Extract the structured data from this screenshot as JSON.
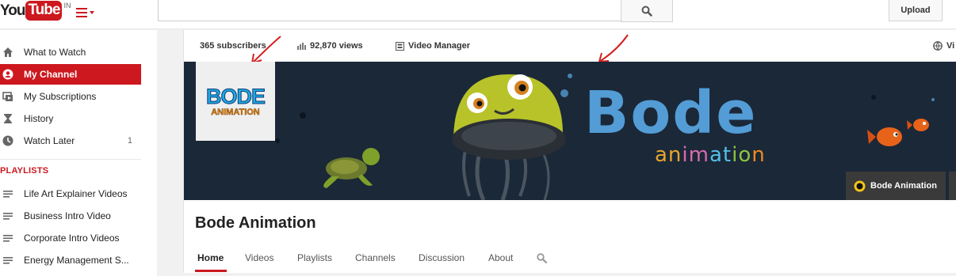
{
  "header": {
    "logo_you": "You",
    "logo_tube": "Tube",
    "region": "IN",
    "search_placeholder": "",
    "upload_label": "Upload"
  },
  "sidebar": {
    "items": [
      {
        "label": "What to Watch",
        "icon": "home-icon"
      },
      {
        "label": "My Channel",
        "icon": "user-icon",
        "active": true
      },
      {
        "label": "My Subscriptions",
        "icon": "subscriptions-icon"
      },
      {
        "label": "History",
        "icon": "hourglass-icon"
      },
      {
        "label": "Watch Later",
        "icon": "clock-icon",
        "count": "1"
      }
    ],
    "playlists_heading": "PLAYLISTS",
    "playlists": [
      {
        "label": "Life Art Explainer Videos"
      },
      {
        "label": "Business Intro Video"
      },
      {
        "label": "Corporate Intro Videos"
      },
      {
        "label": "Energy Management S..."
      }
    ]
  },
  "channel": {
    "subscribers": "365 subscribers",
    "views": "92,870 views",
    "video_manager": "Video Manager",
    "view_as": "Vi",
    "banner_title": "Bode",
    "banner_subtitle": "animation",
    "avatar_line1": "BODE",
    "avatar_line2": "ANIMATION",
    "banner_link_label": "Bode Animation",
    "name": "Bode Animation",
    "tabs": [
      "Home",
      "Videos",
      "Playlists",
      "Channels",
      "Discussion",
      "About"
    ]
  },
  "colors": {
    "brand_red": "#cc181e",
    "banner_bg": "#1b2838",
    "banner_text": "#5aa9e6"
  }
}
